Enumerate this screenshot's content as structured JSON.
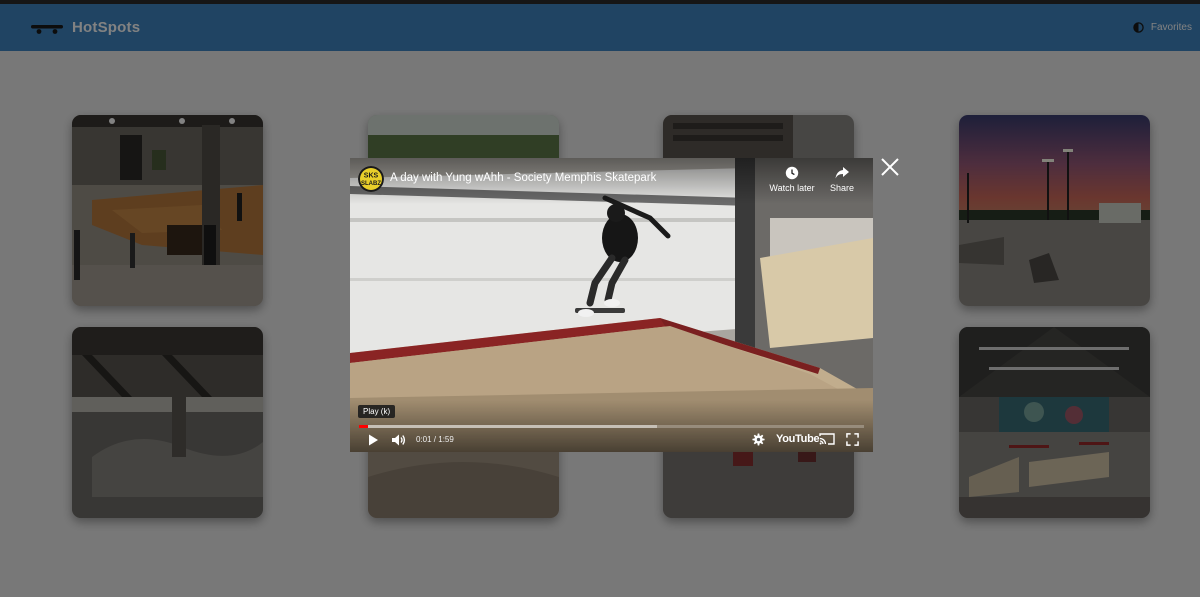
{
  "navbar": {
    "title": "HotSpots",
    "brand_icon": "skateboard-icon",
    "favorites_icon": "contrast-circle-icon",
    "favorites_label": "Favorites",
    "accent_color": "#3f86c2"
  },
  "cards": [
    {
      "name": "skatepark-card-1",
      "scene": "indoor wooden ramp park"
    },
    {
      "name": "skatepark-card-2",
      "scene": "outdoor park with trees"
    },
    {
      "name": "skatepark-card-3",
      "scene": "indoor park"
    },
    {
      "name": "skatepark-card-4",
      "scene": "outdoor park at sunset"
    },
    {
      "name": "skatepark-card-5",
      "scene": "concrete park under bridge"
    },
    {
      "name": "skatepark-card-6",
      "scene": "concrete bowl"
    },
    {
      "name": "skatepark-card-7",
      "scene": "outdoor park with rails"
    },
    {
      "name": "skatepark-card-8",
      "scene": "warehouse park with mural"
    }
  ],
  "modal": {
    "close_icon": "close-icon",
    "video": {
      "title": "A day with Yung wAhh - Society Memphis Skatepark",
      "channel_avatar_text": "SKS SLABZ",
      "watch_later_label": "Watch later",
      "share_label": "Share",
      "tooltip": "Play (k)",
      "current_time": "0:01",
      "duration": "1:59",
      "time_display": "0:01 / 1:59",
      "played_fraction": 0.017,
      "loaded_fraction": 0.59,
      "logo_text": "YouTube",
      "controls": [
        "play-icon",
        "volume-icon",
        "settings-gear-icon",
        "cast-icon",
        "fullscreen-icon"
      ]
    }
  }
}
